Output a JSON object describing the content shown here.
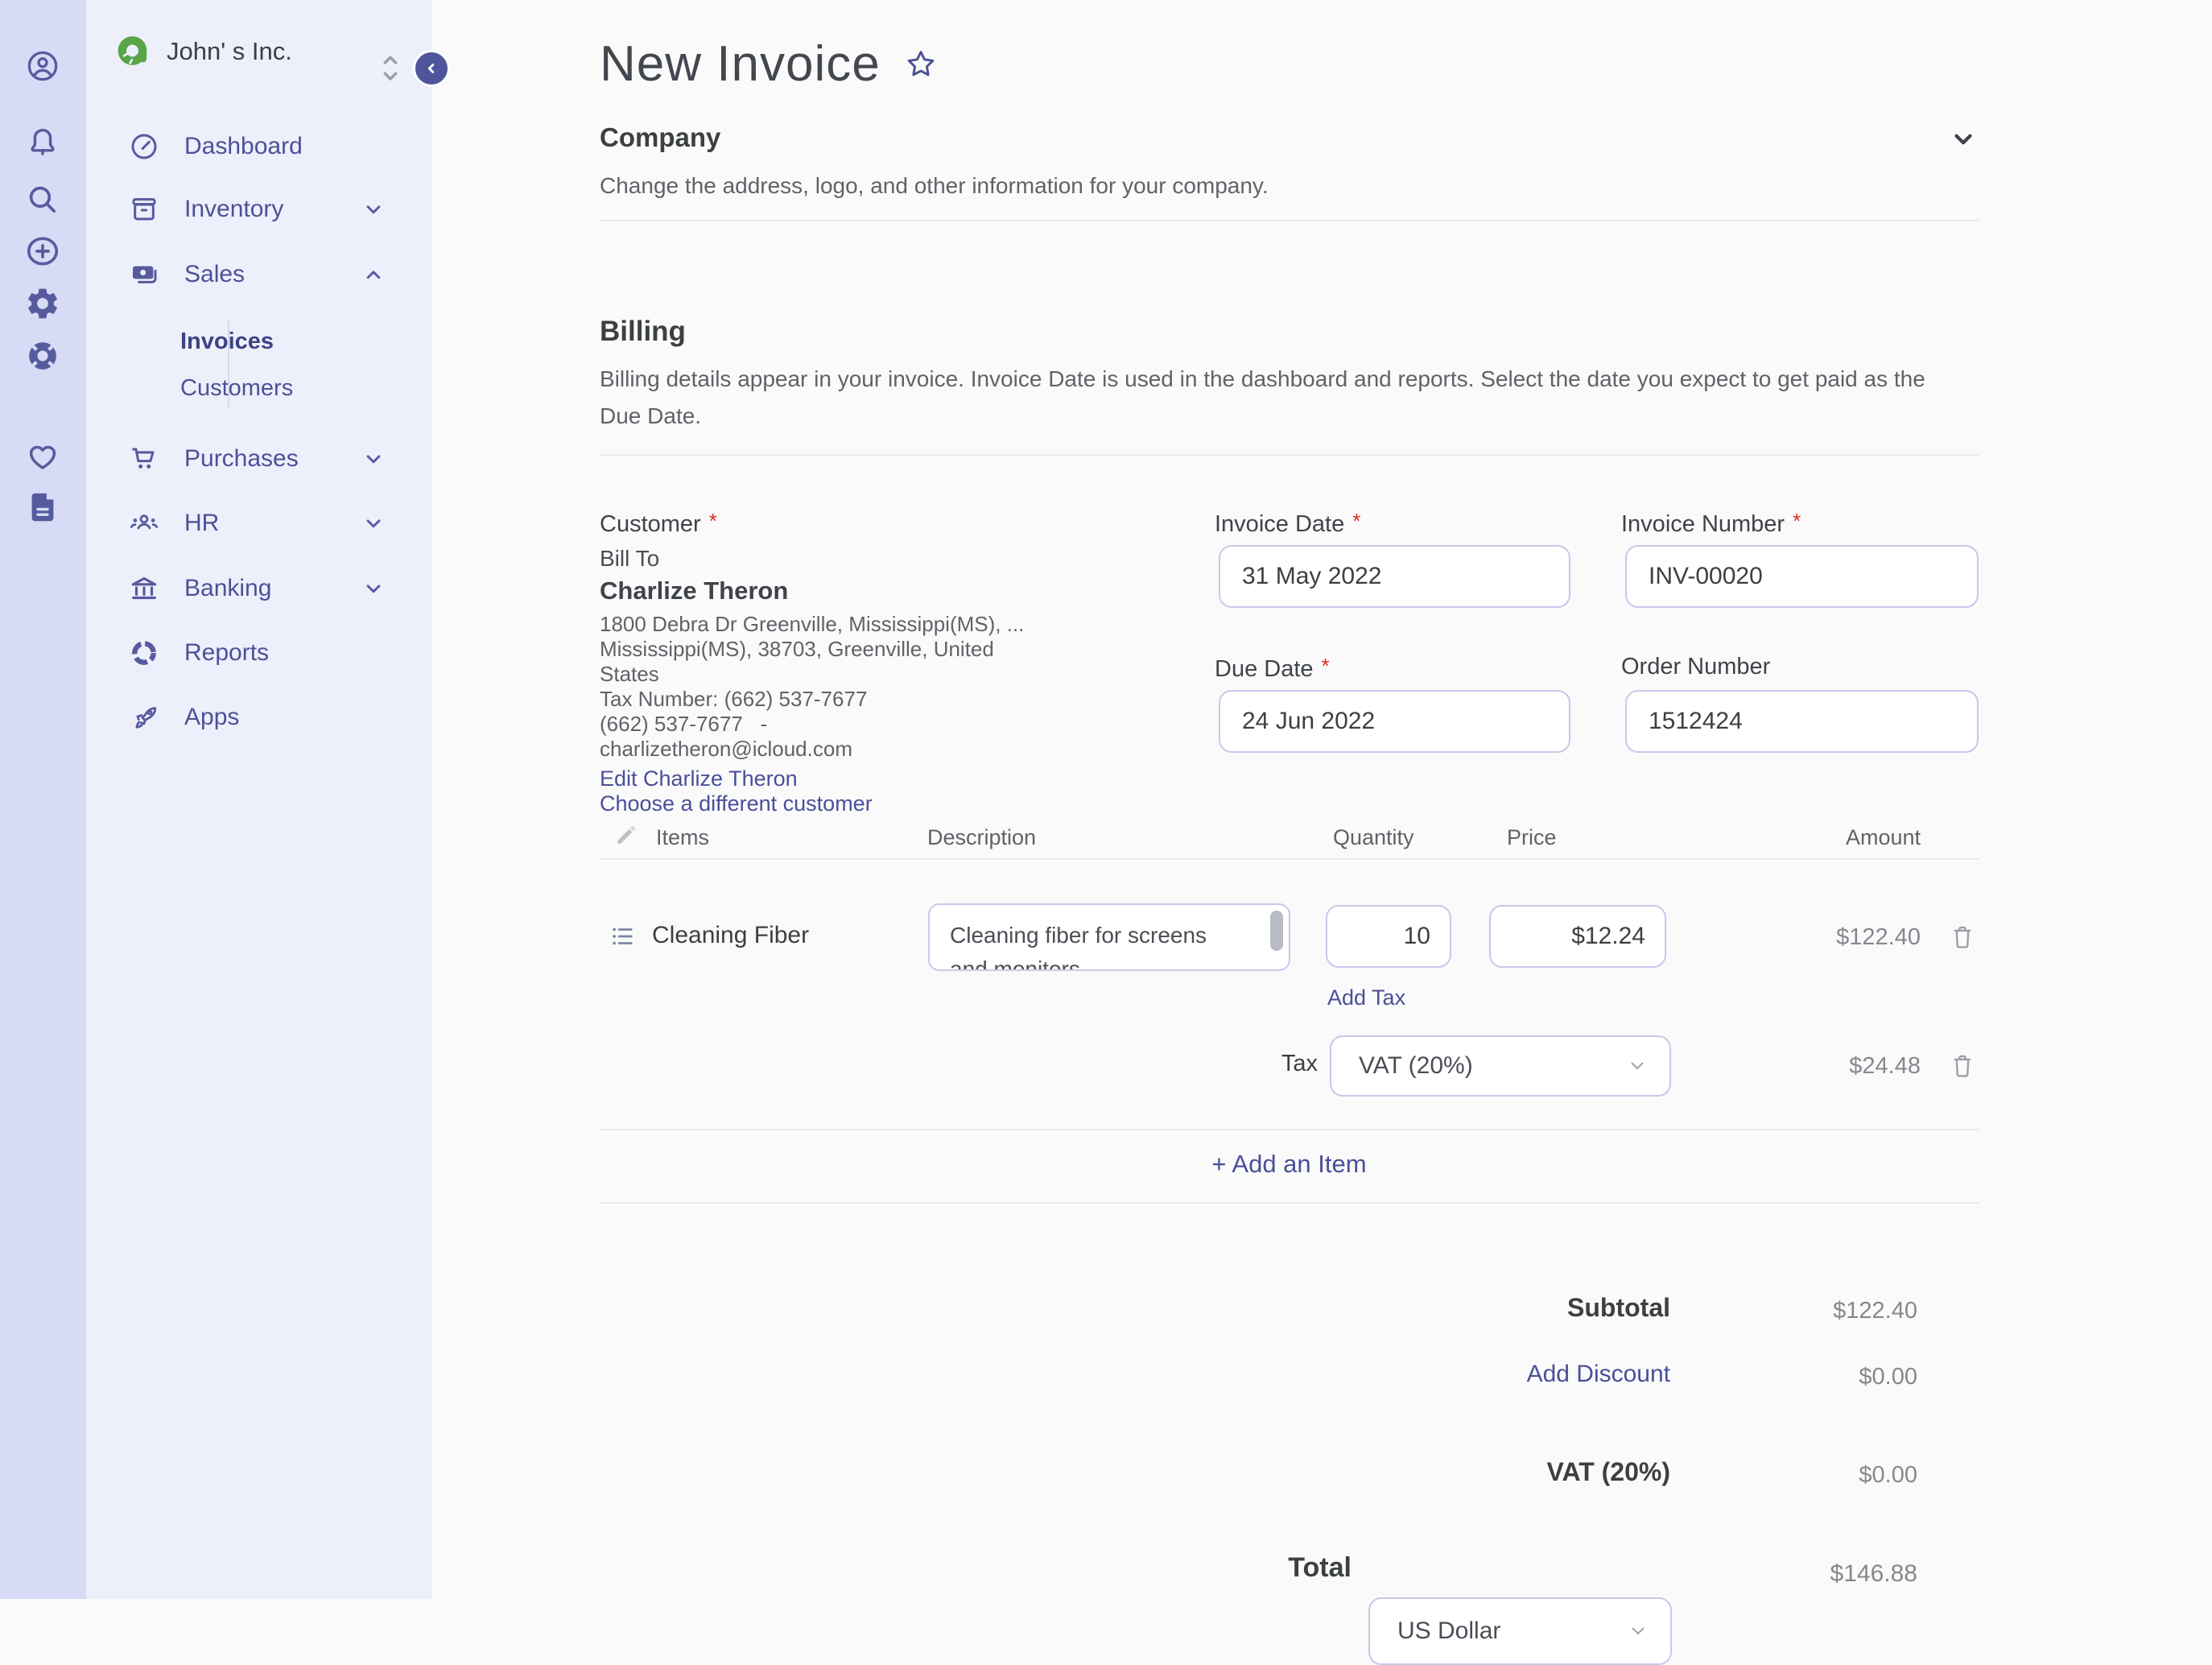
{
  "colors": {
    "accent": "#4c5196",
    "link": "#4a4f9a",
    "rail_bg": "#d8dbf6",
    "sidebar_bg": "#edeffb",
    "logo_green": "#58a447",
    "required": "#d93025",
    "active_nav": "#3d4382"
  },
  "rail": {
    "icons": [
      "user",
      "notifications",
      "search",
      "add",
      "settings",
      "help",
      "favorites",
      "documents"
    ]
  },
  "sidebar": {
    "company_name": "John' s Inc.",
    "items": [
      {
        "label": "Dashboard",
        "icon": "dashboard-icon",
        "chevron": ""
      },
      {
        "label": "Inventory",
        "icon": "inventory-icon",
        "chevron": "down"
      },
      {
        "label": "Sales",
        "icon": "sales-icon",
        "chevron": "up"
      },
      {
        "label": "Purchases",
        "icon": "cart-icon",
        "chevron": "down"
      },
      {
        "label": "HR",
        "icon": "people-icon",
        "chevron": "down"
      },
      {
        "label": "Banking",
        "icon": "bank-icon",
        "chevron": "down"
      },
      {
        "label": "Reports",
        "icon": "reports-icon",
        "chevron": ""
      },
      {
        "label": "Apps",
        "icon": "rocket-icon",
        "chevron": ""
      }
    ],
    "sales_children": [
      {
        "label": "Invoices",
        "active": true
      },
      {
        "label": "Customers",
        "active": false
      }
    ]
  },
  "header": {
    "title": "New Invoice"
  },
  "company_section": {
    "title": "Company",
    "description": "Change the address, logo, and other information for your company."
  },
  "billing_section": {
    "title": "Billing",
    "description": "Billing details appear in your invoice. Invoice Date is used in the dashboard and reports. Select the date you expect to get paid as the Due Date."
  },
  "customer": {
    "label": "Customer",
    "bill_to": "Bill To",
    "name": "Charlize Theron",
    "address_line1": "1800 Debra Dr Greenville, Mississippi(MS),  ...",
    "address_line2": "Mississippi(MS), 38703, Greenville, United",
    "address_line3": "States",
    "tax_number": "Tax Number: (662) 537-7677",
    "phone": "(662) 537-7677   -",
    "email": "charlizetheron@icloud.com",
    "edit_link": "Edit Charlize Theron",
    "choose_link": "Choose a different customer"
  },
  "fields": {
    "invoice_date": {
      "label": "Invoice Date",
      "value": "31 May 2022"
    },
    "invoice_number": {
      "label": "Invoice Number",
      "value": "INV-00020"
    },
    "due_date": {
      "label": "Due Date",
      "value": "24 Jun 2022"
    },
    "order_number": {
      "label": "Order Number",
      "value": "1512424"
    }
  },
  "items_table": {
    "headers": {
      "items": "Items",
      "description": "Description",
      "quantity": "Quantity",
      "price": "Price",
      "amount": "Amount"
    },
    "row": {
      "name": "Cleaning Fiber",
      "description": "Cleaning fiber for screens and monitors",
      "quantity": "10",
      "price": "$12.24",
      "amount": "$122.40"
    },
    "add_tax_label": "Add Tax",
    "tax_row": {
      "label": "Tax",
      "value": "VAT (20%)",
      "amount": "$24.48"
    },
    "add_item_label": "+ Add an Item"
  },
  "totals": {
    "subtotal_label": "Subtotal",
    "subtotal_value": "$122.40",
    "discount_label": "Add Discount",
    "discount_value": "$0.00",
    "vat_label": "VAT (20%)",
    "vat_value": "$0.00",
    "total_label": "Total",
    "currency": "US Dollar",
    "total_value": "$146.88"
  }
}
